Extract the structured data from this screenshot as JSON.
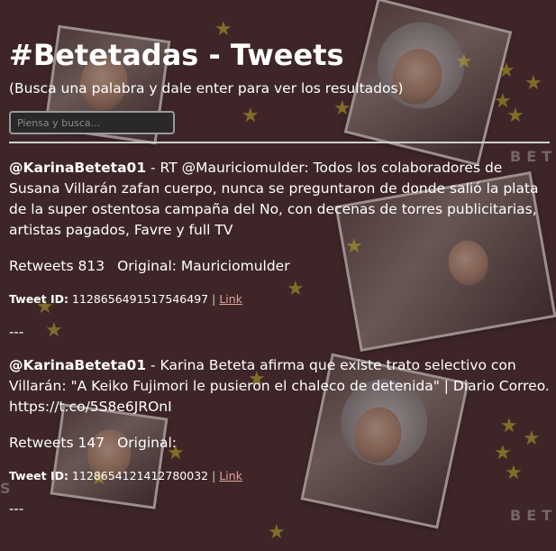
{
  "header": {
    "title": "#Betetadas - Tweets",
    "subtitle": "(Busca una palabra y dale enter para ver los resultados)"
  },
  "search": {
    "placeholder": "Piensa y busca..."
  },
  "background": {
    "watermark_text": "BETE",
    "watermark_text_left": "S"
  },
  "tweets": [
    {
      "user": "@KarinaBeteta01",
      "text": " - RT @Mauriciomulder: Todos los colaboradores de Susana Villarán zafan cuerpo, nunca se preguntaron de donde salió la plata de la super ostentosa campaña del No, con decenas de torres publicitarias, artistas pagados, Favre y full TV",
      "retweets_label": "Retweets 813",
      "original_label": "Original: Mauriciomulder",
      "tweet_id_label": "Tweet ID:",
      "tweet_id": "1128656491517546497",
      "link_label": "Link",
      "separator": "---"
    },
    {
      "user": "@KarinaBeteta01",
      "text": " - Karina Beteta afirma que existe trato selectivo con Villarán: \"A Keiko Fujimori le pusieron el chaleco de detenida\" | Diario Correo. https://t.co/5S8e6JROnI",
      "retweets_label": "Retweets 147",
      "original_label": "Original:",
      "tweet_id_label": "Tweet ID:",
      "tweet_id": "1128654121412780032",
      "link_label": "Link",
      "separator": "---"
    }
  ]
}
